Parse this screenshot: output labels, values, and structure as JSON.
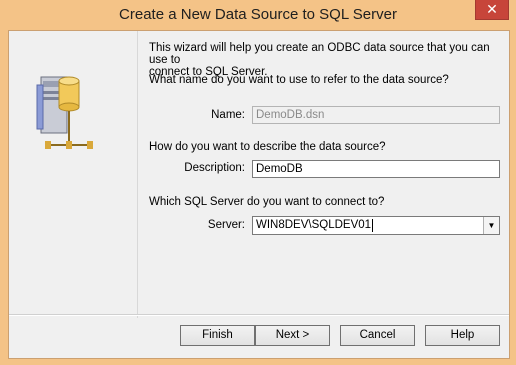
{
  "window": {
    "title": "Create a New Data Source to SQL Server",
    "close_symbol": "✕"
  },
  "wizard": {
    "intro_line1": "This wizard will help you create an ODBC data source that you can use to",
    "intro_line2": "connect to SQL Server.",
    "name_question": "What name do you want to use to refer to the data source?",
    "name_label": "Name:",
    "name_value": "DemoDB.dsn",
    "desc_question": "How do you want to describe the data source?",
    "desc_label": "Description:",
    "desc_value": "DemoDB",
    "server_question": "Which SQL Server do you want to connect to?",
    "server_label": "Server:",
    "server_value": "WIN8DEV\\SQLDEV01"
  },
  "buttons": {
    "finish": "Finish",
    "next": "Next >",
    "cancel": "Cancel",
    "help": "Help"
  },
  "icons": {
    "illustration": "database-server-network-icon",
    "dropdown": "chevron-down-icon"
  }
}
